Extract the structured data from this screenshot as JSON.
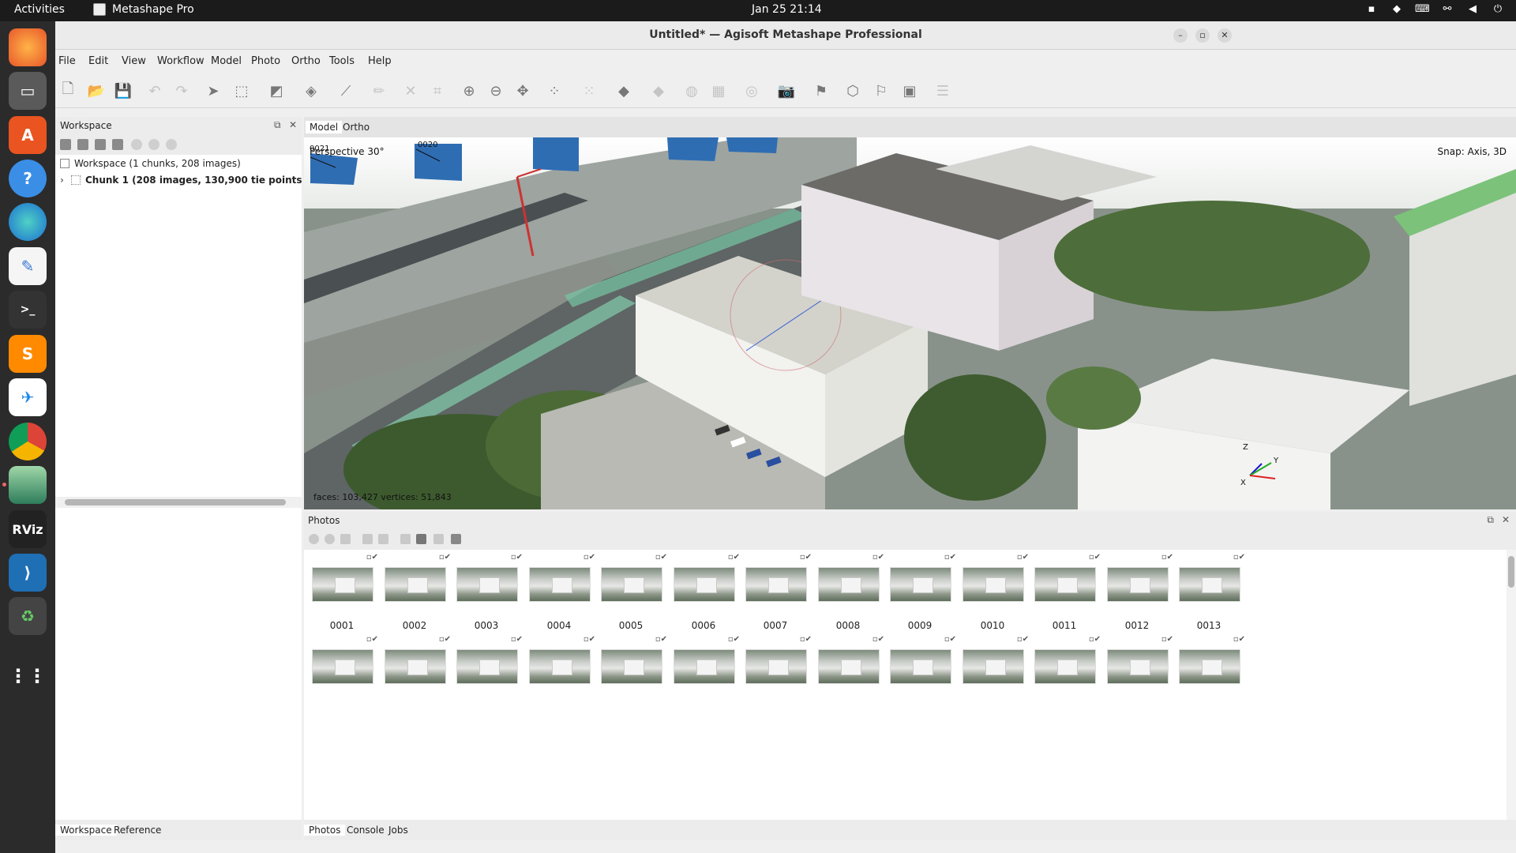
{
  "topbar": {
    "activities": "Activities",
    "app_name": "Metashape Pro",
    "clock": "Jan 25  21:14"
  },
  "window": {
    "title": "Untitled* — Agisoft Metashape Professional"
  },
  "menu": [
    "File",
    "Edit",
    "View",
    "Workflow",
    "Model",
    "Photo",
    "Ortho",
    "Tools",
    "Help"
  ],
  "workspace": {
    "title": "Workspace",
    "root": "Workspace (1 chunks, 208 images)",
    "chunk": "Chunk 1 (208 images, 130,900 tie points)",
    "tabs": [
      "Workspace",
      "Reference"
    ]
  },
  "view": {
    "tabs": [
      "Model",
      "Ortho"
    ],
    "projection": "Perspective 30°",
    "snap": "Snap: Axis, 3D",
    "stats": "faces: 103,427  vertices: 51,843",
    "camera_labels": [
      "0021",
      "0020"
    ],
    "axes": [
      "Z",
      "Y",
      "X"
    ]
  },
  "photos": {
    "title": "Photos",
    "row1": [
      "0001",
      "0002",
      "0003",
      "0004",
      "0005",
      "0006",
      "0007",
      "0008",
      "0009",
      "0010",
      "0011",
      "0012",
      "0013"
    ],
    "tabs": [
      "Photos",
      "Console",
      "Jobs"
    ]
  },
  "colors": {
    "topbar": "#1b1b1b",
    "dock": "#2b2b2b",
    "camera_plane": "#2f6db3"
  }
}
